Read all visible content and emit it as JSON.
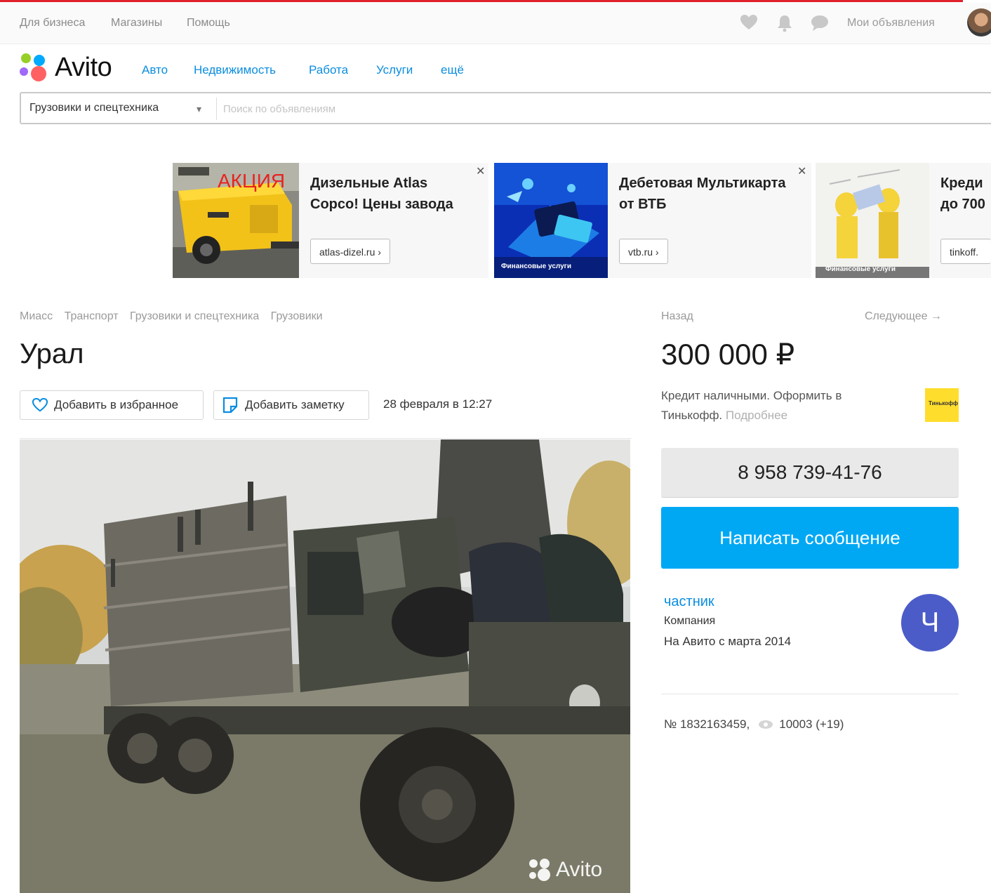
{
  "topbar": {
    "links": [
      "Для бизнеса",
      "Магазины",
      "Помощь"
    ],
    "my_ads": "Мои объявления",
    "icons": [
      "heart-icon",
      "bell-icon",
      "chat-icon"
    ]
  },
  "header": {
    "logo_text": "Avito",
    "nav": [
      "Авто",
      "Недвижимость",
      "Работа",
      "Услуги",
      "ещё"
    ]
  },
  "search": {
    "category": "Грузовики и спецтехника",
    "placeholder": "Поиск по объявлениям"
  },
  "ads": [
    {
      "badge": "АКЦИЯ",
      "title": "Дизельные Atlas Copco! Цены завода",
      "button": "atlas-dizel.ru ›"
    },
    {
      "title": "Дебетовая Мультикарта от ВТБ",
      "button": "vtb.ru ›",
      "image_caption": "Финансовые услуги"
    },
    {
      "title": "Креди до 700",
      "button": "tinkoff.",
      "image_caption": "Финансовые услуги"
    }
  ],
  "breadcrumbs": [
    "Миасс",
    "Транспорт",
    "Грузовики и спецтехника",
    "Грузовики"
  ],
  "listing": {
    "title": "Урал",
    "favorite_label": "Добавить в избранное",
    "note_label": "Добавить заметку",
    "date": "28 февраля в 12:27",
    "watermark": "Avito"
  },
  "sidebar": {
    "back": "Назад",
    "next": "Следующее →",
    "price": "300 000 ₽",
    "credit_text": "Кредит наличными. Оформить в Тинькофф.",
    "credit_more": "Подробнее",
    "tinkoff_logo": "Тинькофф",
    "phone": "8 958 739-41-76",
    "message_btn": "Написать сообщение",
    "seller_name": "частник",
    "seller_type": "Компания",
    "seller_since": "На Авито с марта 2014",
    "seller_initial": "Ч",
    "ad_number": "№ 1832163459,",
    "views": "10003 (+19)"
  },
  "colors": {
    "accent": "#00a8f4",
    "link": "#0a8de0",
    "avatar": "#4b5cc8",
    "tinkoff": "#ffdd2d",
    "top_line": "#e0202a"
  }
}
